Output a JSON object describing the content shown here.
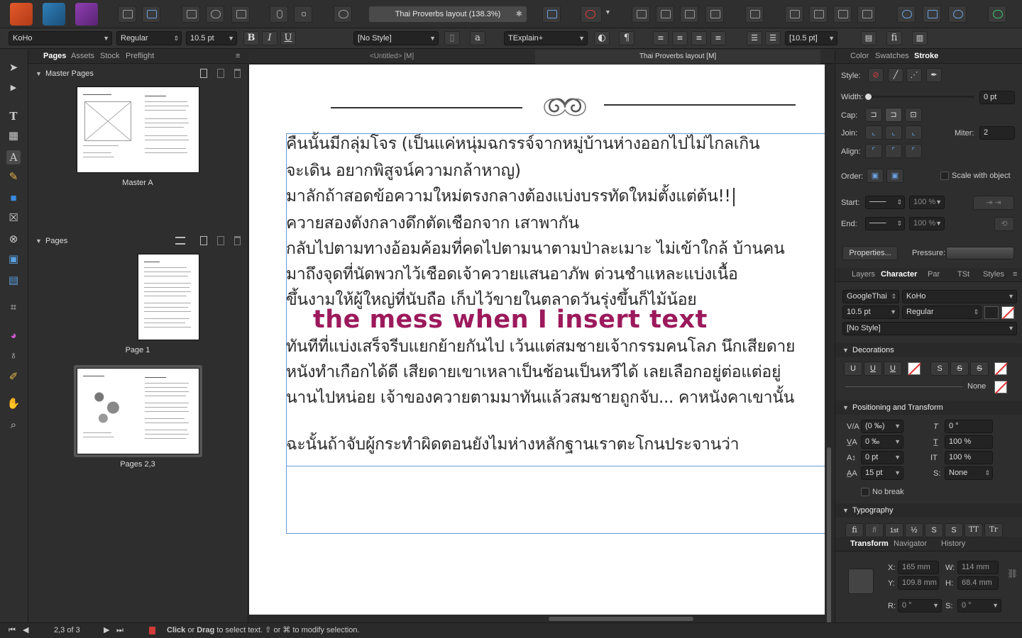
{
  "app": {
    "document_title": "Thai Proverbs layout (138.3%)",
    "title_star": "✱"
  },
  "context_bar": {
    "font_family": "KoHo",
    "font_style": "Regular",
    "font_size": "10.5 pt",
    "bold": "B",
    "italic": "I",
    "underline": "U",
    "char_style": "[No Style]",
    "para_style": "TExplain+",
    "leading": "[10.5 pt]",
    "a_glyph": "a",
    "pilcrow": "¶",
    "fi_glyph": "fi"
  },
  "left_panel": {
    "tabs": [
      "Pages",
      "Assets",
      "Stock",
      "Preflight"
    ],
    "active_tab": "Pages",
    "master_section": "Master Pages",
    "master_thumb_label": "Master A",
    "pages_section": "Pages",
    "page_thumbs": [
      {
        "label": "Page 1"
      },
      {
        "label": "Pages 2,3"
      }
    ]
  },
  "doc_tabs": [
    "<Untitled> [M]",
    "Thai Proverbs layout [M]"
  ],
  "canvas": {
    "lines": [
      "คืนนั้นมีกลุ่มโจร (เป็นแค่หนุ่มฉกรรจ์จากหมู่บ้านห่างออกไปไม่ไกลเกิน",
      "จะเดิน อยากพิสูจน์ความกล้าหาญ)",
      "มาลักถ้าสอดข้อความใหม่ตรงกลางต้องแบ่งบรรทัดใหม่ตั้งแต่ต้น!!",
      "ควายสองตังกลางดึกตัดเชือกจาก เสาพากัน",
      "กลับไปตามทางอ้อมค้อมที่คดไปตามนาตามป่าละเมาะ ไม่เข้าใกล้ บ้านคน",
      "มาถึงจุดที่นัดพวกไว้เชือดเจ้าควายแสนอาภัพ ด่วนชำแหละแบ่งเนื้อ",
      "ขึ้นงามให้ผู้ใหญ่ที่นับถือ เก็บไว้ขายในตลาดวันรุ่งขึ้นก็ไม้น้อย",
      "ทันทีที่แบ่งเสร็จรีบแยกย้ายกันไป เว้นแต่สมชายเจ้ากรรมคนโลภ นึกเสียดาย",
      "หนังทำเกือกได้ดี เสียดายเขาเหลาเป็นช้อนเป็นหวีได้ เลยเลือกอยู่ต่อแต่อยู่",
      "นานไปหน่อย เจ้าของควายตามมาทันแล้วสมชายถูกจับ... คาหนังคาเขานั้น",
      "ฉะนั้นถ้าจับผู้กระทำผิดตอนยังไมห่างหลักฐานเราตะโกนประจานว่า"
    ],
    "overlay_text": "the mess when I insert text"
  },
  "right_panel": {
    "top_tabs": [
      "Color",
      "Swatches",
      "Stroke"
    ],
    "top_active": "Stroke",
    "stroke": {
      "style_label": "Style:",
      "width_label": "Width:",
      "width_value": "0 pt",
      "cap_label": "Cap:",
      "join_label": "Join:",
      "miter_label": "Miter:",
      "miter_value": "2",
      "align_label": "Align:",
      "order_label": "Order:",
      "scale_label": "Scale with object",
      "start_label": "Start:",
      "end_label": "End:",
      "start_pct": "100 %",
      "end_pct": "100 %",
      "properties_button": "Properties...",
      "pressure_label": "Pressure:"
    },
    "mid_tabs": [
      "Layers",
      "Character",
      "Par",
      "TSt",
      "Styles"
    ],
    "mid_active": "Character",
    "character": {
      "language": "GoogleThai",
      "font": "KoHo",
      "size": "10.5 pt",
      "style": "Regular",
      "char_style": "[No Style]",
      "decorations_section": "Decorations",
      "deco_u1": "U",
      "deco_u2": "U",
      "deco_u3": "U",
      "deco_s1": "S",
      "deco_s2": "S",
      "deco_s3": "S",
      "deco_none": "None",
      "pos_section": "Positioning and Transform",
      "tracking": "(0 ‰)",
      "kerning": "0 ‰",
      "baseline": "0 pt",
      "leading": "15 pt",
      "shear": "0 °",
      "hscale": "100 %",
      "vscale": "100 %",
      "script": "None",
      "no_break": "No break",
      "typography_section": "Typography",
      "typo_glyphs": [
        "fi",
        "fi",
        "1st",
        "½",
        "S",
        "S",
        "TT",
        "Tr"
      ]
    },
    "bottom_tabs": [
      "Transform",
      "Navigator",
      "History"
    ],
    "bottom_active": "Transform",
    "transform": {
      "x": "165 mm",
      "y": "109.8 mm",
      "w": "114 mm",
      "h": "68.4 mm",
      "r": "0 °",
      "s": "0 °",
      "x_label": "X:",
      "y_label": "Y:",
      "w_label": "W:",
      "h_label": "H:",
      "r_label": "R:",
      "s_label": "S:"
    }
  },
  "status_bar": {
    "page_indicator": "2,3 of 3",
    "hint_click": "Click",
    "hint_or": " or ",
    "hint_drag": "Drag",
    "hint_rest": " to select text. ⇧ or ⌘ to modify selection."
  },
  "colors": {
    "overlay": "#9c1a5c",
    "selection": "#6a98d6"
  }
}
